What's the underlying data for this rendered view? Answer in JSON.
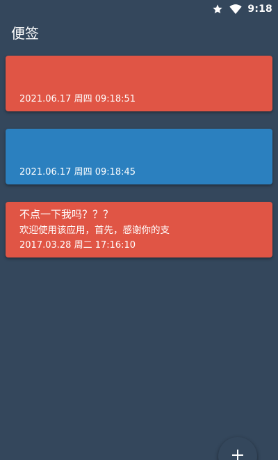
{
  "status_bar": {
    "time": "9:18",
    "icons": [
      "star-icon",
      "wifi-icon"
    ]
  },
  "app_bar": {
    "title": "便签"
  },
  "notes": [
    {
      "title": "",
      "preview": "",
      "date": "2021.06.17 周四 09:18:51",
      "color": "#e05545"
    },
    {
      "title": "",
      "preview": "",
      "date": "2021.06.17 周四 09:18:45",
      "color": "#2b80bf"
    },
    {
      "title": "不点一下我吗？？？",
      "preview": "欢迎使用该应用，首先，感谢你的支",
      "date": "2017.03.28 周二 17:16:10",
      "color": "#e05545"
    }
  ],
  "fab": {
    "icon": "plus-icon"
  },
  "colors": {
    "background": "#34475c",
    "red_note": "#e05545",
    "blue_note": "#2b80bf"
  }
}
